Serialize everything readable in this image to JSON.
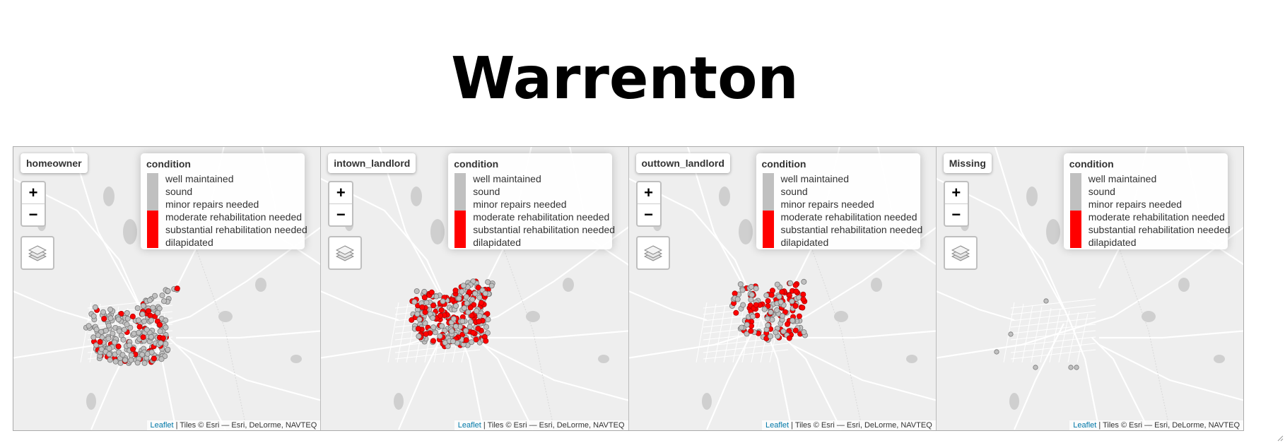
{
  "page_title": "Warrenton",
  "legend": {
    "title": "condition",
    "items": [
      "well maintained",
      "sound",
      "minor repairs needed",
      "moderate rehabilitation needed",
      "substantial rehabilitation needed",
      "dilapidated"
    ],
    "colors": {
      "good": "#c0c0c0",
      "poor": "#ff0000"
    }
  },
  "controls": {
    "zoom_in": "+",
    "zoom_out": "−"
  },
  "attribution": {
    "link": "Leaflet",
    "text": " | Tiles © Esri — Esri, DeLorme, NAVTEQ"
  },
  "panels": [
    {
      "label": "homeowner"
    },
    {
      "label": "intown_landlord"
    },
    {
      "label": "outtown_landlord"
    },
    {
      "label": "Missing"
    }
  ]
}
